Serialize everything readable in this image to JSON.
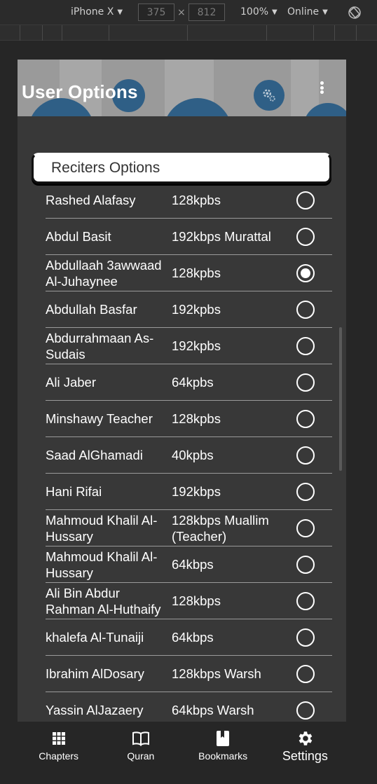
{
  "devtools": {
    "device": "iPhone X",
    "width": "375",
    "height": "812",
    "zoom": "100%",
    "network": "Online"
  },
  "header": {
    "title": "User Options"
  },
  "section": {
    "title": "Reciters Options"
  },
  "reciters": [
    {
      "name": "Rashed Alafasy",
      "quality": "128kpbs",
      "selected": false
    },
    {
      "name": "Abdul Basit",
      "quality": "192kbps Murattal",
      "selected": false
    },
    {
      "name": "Abdullaah 3awwaad Al-Juhaynee",
      "quality": "128kpbs",
      "selected": true
    },
    {
      "name": "Abdullah Basfar",
      "quality": "192kpbs",
      "selected": false
    },
    {
      "name": "Abdurrahmaan As-Sudais",
      "quality": "192kpbs",
      "selected": false
    },
    {
      "name": "Ali Jaber",
      "quality": "64kpbs",
      "selected": false
    },
    {
      "name": "Minshawy Teacher",
      "quality": "128kpbs",
      "selected": false
    },
    {
      "name": "Saad AlGhamadi",
      "quality": "40kpbs",
      "selected": false
    },
    {
      "name": "Hani Rifai",
      "quality": "192kbps",
      "selected": false
    },
    {
      "name": "Mahmoud Khalil Al-Hussary",
      "quality": "128kbps Muallim (Teacher)",
      "selected": false
    },
    {
      "name": "Mahmoud Khalil Al-Hussary",
      "quality": "64kbps",
      "selected": false
    },
    {
      "name": "Ali Bin Abdur Rahman Al-Huthaify",
      "quality": "128kbps",
      "selected": false
    },
    {
      "name": "khalefa Al-Tunaiji",
      "quality": "64kbps",
      "selected": false
    },
    {
      "name": "Ibrahim AlDosary",
      "quality": "128kbps Warsh",
      "selected": false
    },
    {
      "name": "Yassin AlJazaery",
      "quality": "64kbps Warsh",
      "selected": false
    }
  ],
  "nav": {
    "chapters": "Chapters",
    "quran": "Quran",
    "bookmarks": "Bookmarks",
    "settings": "Settings",
    "active": "settings"
  }
}
